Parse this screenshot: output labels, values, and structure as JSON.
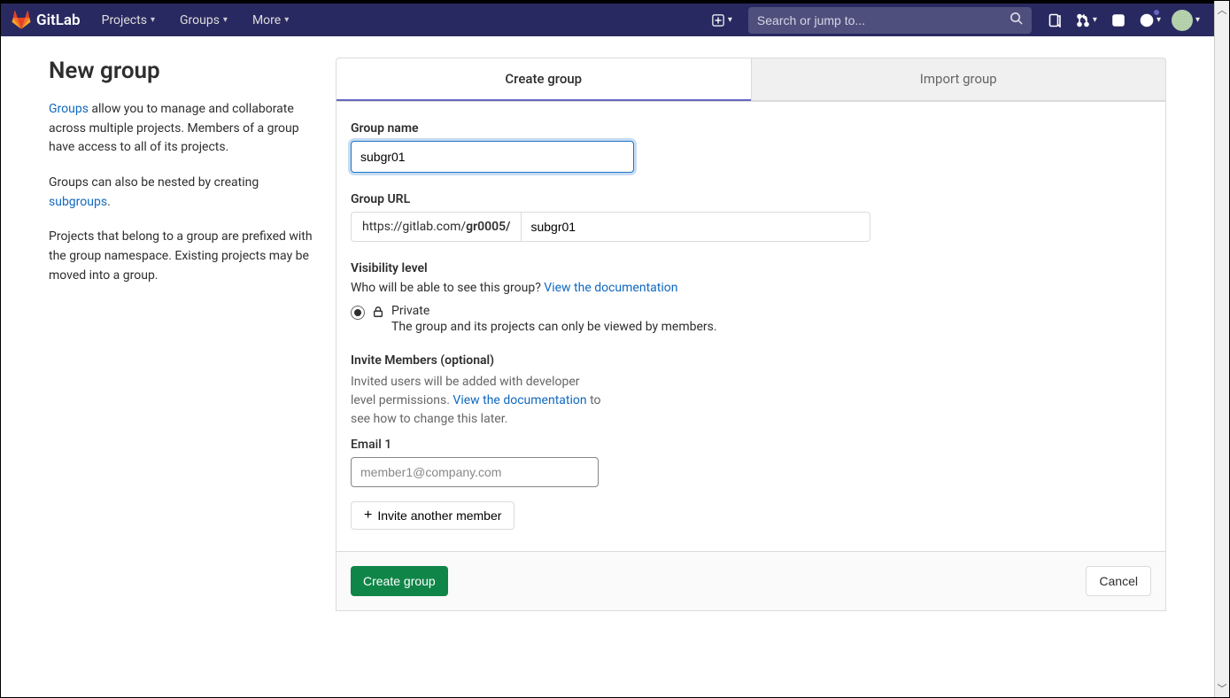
{
  "brand": "GitLab",
  "topnav": {
    "projects": "Projects",
    "groups": "Groups",
    "more": "More"
  },
  "search": {
    "placeholder": "Search or jump to..."
  },
  "sidebar": {
    "title": "New group",
    "p1_a": "Groups",
    "p1_b": " allow you to manage and collaborate across multiple projects. Members of a group have access to all of its projects.",
    "p2_a": "Groups can also be nested by creating ",
    "p2_b": "subgroups",
    "p2_c": ".",
    "p3": "Projects that belong to a group are prefixed with the group namespace. Existing projects may be moved into a group."
  },
  "tabs": {
    "create": "Create group",
    "import": "Import group"
  },
  "form": {
    "name_label": "Group name",
    "name_value": "subgr01",
    "url_label": "Group URL",
    "url_prefix_a": "https://gitlab.com/",
    "url_prefix_b": "gr0005/",
    "url_value": "subgr01",
    "visibility_label": "Visibility level",
    "visibility_help": "Who will be able to see this group? ",
    "view_doc": "View the documentation",
    "private_title": "Private",
    "private_desc": "The group and its projects can only be viewed by members.",
    "invite_label": "Invite Members (optional)",
    "invite_desc_a": "Invited users will be added with developer level permissions. ",
    "invite_desc_b": " to see how to change this later.",
    "email1_label": "Email 1",
    "email1_placeholder": "member1@company.com",
    "invite_another": "Invite another member",
    "submit": "Create group",
    "cancel": "Cancel"
  }
}
